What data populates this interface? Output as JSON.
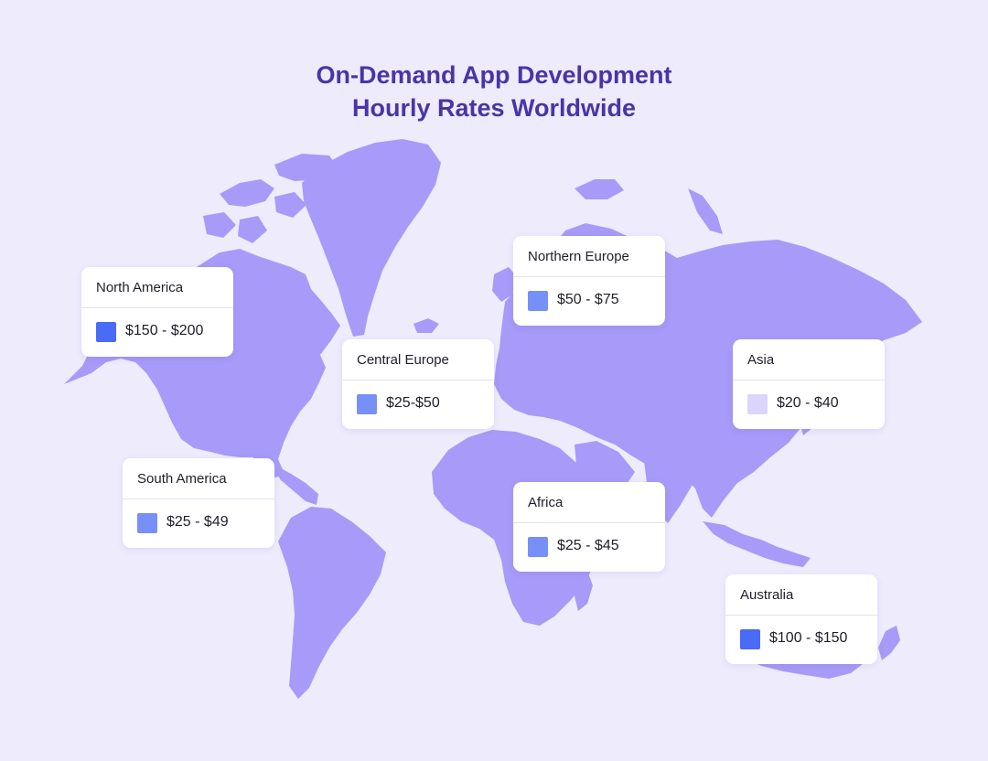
{
  "title": {
    "line1": "On-Demand App Development",
    "line2": "Hourly Rates Worldwide"
  },
  "regions": [
    {
      "id": "north-america",
      "name": "North America",
      "rate": "$150 - $200",
      "color": "#4A6BF5"
    },
    {
      "id": "south-america",
      "name": "South America",
      "rate": "$25 - $49",
      "color": "#7690F8"
    },
    {
      "id": "central-europe",
      "name": "Central Europe",
      "rate": "$25-$50",
      "color": "#7690F8"
    },
    {
      "id": "northern-europe",
      "name": "Northern Europe",
      "rate": "$50 - $75",
      "color": "#7690F8"
    },
    {
      "id": "asia",
      "name": "Asia",
      "rate": "$20 - $40",
      "color": "#DCD5FB"
    },
    {
      "id": "africa",
      "name": "Africa",
      "rate": "$25 - $45",
      "color": "#7690F8"
    },
    {
      "id": "australia",
      "name": "Australia",
      "rate": "$100 - $150",
      "color": "#4A6BF5"
    }
  ],
  "colors": {
    "background": "#EEEBFD",
    "land": "#A89AF8",
    "title": "#4A34A6",
    "card": "#FFFFFF"
  }
}
